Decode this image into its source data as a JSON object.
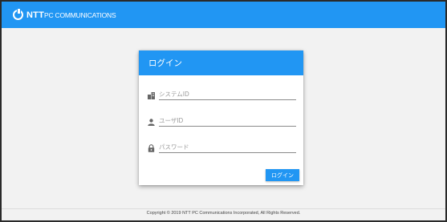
{
  "header": {
    "logo_main": "NTT",
    "logo_sub": "PC COMMUNICATIONS"
  },
  "login": {
    "title": "ログイン",
    "fields": [
      {
        "placeholder": "システムID",
        "icon": "building-icon"
      },
      {
        "placeholder": "ユーザID",
        "icon": "person-icon"
      },
      {
        "placeholder": "パスワード",
        "icon": "lock-icon"
      }
    ],
    "button_label": "ログイン"
  },
  "footer": {
    "copyright": "Copyright © 2019 NTT PC Communications Incorporated, All Rights Reserved."
  },
  "colors": {
    "brand": "#2196f3",
    "background": "#f2f2f2"
  }
}
